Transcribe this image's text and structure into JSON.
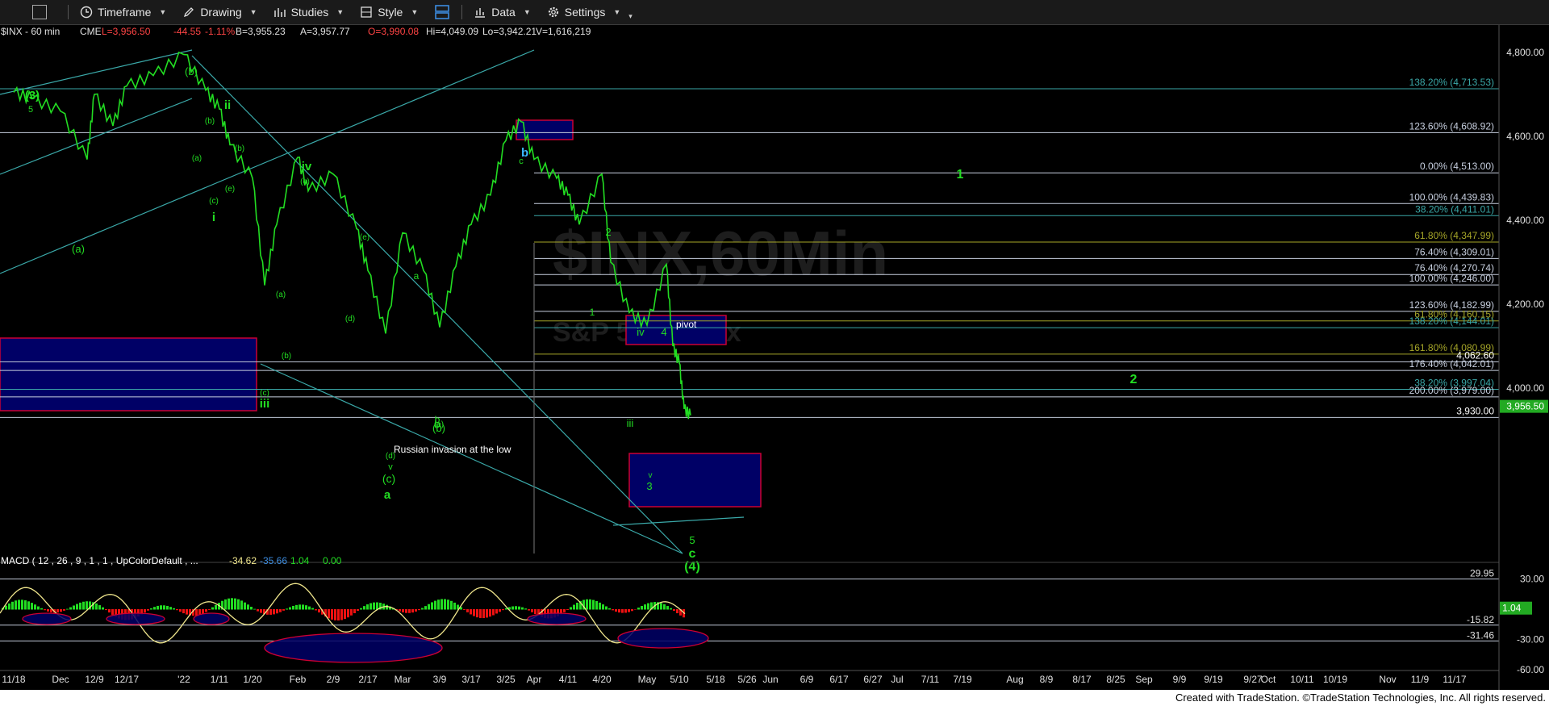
{
  "toolbar": {
    "items": [
      "Timeframe",
      "Drawing",
      "Studies",
      "Style",
      "Data",
      "Settings"
    ]
  },
  "header": {
    "symbol": "$INX - 60 min",
    "exchange": "CME",
    "last": "L=3,956.50",
    "change": "-44.55",
    "change_pct": "-1.11%",
    "bid": "B=3,955.23",
    "ask": "A=3,957.77",
    "open": "O=3,990.08",
    "high": "Hi=4,049.09",
    "low": "Lo=3,942.21",
    "volume": "V=1,616,219"
  },
  "watermark": {
    "line1": "$INX,60Min",
    "line2": "S&P 500 Index"
  },
  "colors": {
    "price": "#22dd22",
    "wave_label": "#22dd22",
    "fib_line": "#d0d8e8",
    "fib_label": "#c8d0e0",
    "teal": "#3aa8a8",
    "olive": "#a6a628",
    "box_fill": "#000066",
    "box_border": "#cc0033",
    "macd_line": "#f0e68c",
    "macd_pos": "#22dd22",
    "macd_neg": "#ee1111",
    "last_price_bg": "#22aa22"
  },
  "chart_data": {
    "type": "line",
    "title": "$INX - 60 min",
    "ylim": [
      3800,
      4880
    ],
    "y_ticks": [
      "4,800.00",
      "4,600.00",
      "4,400.00",
      "4,200.00",
      "4,000.00"
    ],
    "x_ticks": [
      "11/18",
      "Dec",
      "12/9",
      "12/17",
      "'22",
      "1/11",
      "1/20",
      "Feb",
      "2/9",
      "2/17",
      "Mar",
      "3/9",
      "3/17",
      "3/25",
      "Apr",
      "4/11",
      "4/20",
      "May",
      "5/10",
      "5/18",
      "5/26",
      "Jun",
      "6/9",
      "6/17",
      "6/27",
      "Jul",
      "7/11",
      "7/19",
      "Aug",
      "8/9",
      "8/17",
      "8/25",
      "Sep",
      "9/9",
      "9/19",
      "9/27",
      "Oct",
      "10/11",
      "10/19",
      "Nov",
      "11/9",
      "11/17"
    ],
    "series": [
      {
        "x": [
          "11/18",
          "11/26",
          "Dec",
          "12/6",
          "12/9",
          "12/14",
          "12/17",
          "12/22",
          "'22",
          "1/5",
          "1/11",
          "1/14",
          "1/20",
          "1/24",
          "1/27",
          "Feb",
          "2/2",
          "2/9",
          "2/14",
          "2/17",
          "2/24",
          "Mar",
          "3/4",
          "3/9",
          "3/14",
          "3/17",
          "3/22",
          "3/25",
          "3/29",
          "Apr",
          "4/6",
          "4/11",
          "4/14",
          "4/20",
          "4/22",
          "4/26",
          "May",
          "5/4",
          "5/5",
          "5/10",
          "5/11",
          "5/12"
        ],
        "values": [
          4705,
          4690,
          4660,
          4545,
          4700,
          4625,
          4720,
          4745,
          4795,
          4710,
          4665,
          4580,
          4500,
          4245,
          4390,
          4550,
          4470,
          4510,
          4380,
          4280,
          4130,
          4370,
          4280,
          4145,
          4290,
          4390,
          4460,
          4590,
          4635,
          4545,
          4500,
          4460,
          4390,
          4510,
          4300,
          4180,
          4150,
          4295,
          4100,
          4060,
          3950,
          3935
        ]
      }
    ],
    "fib_levels": [
      {
        "label": "138.20% (4,713.53)",
        "value": 4713.53,
        "color": "#3aa8a8"
      },
      {
        "label": "123.60% (4,608.92)",
        "value": 4608.92,
        "color": "#c8d0e0"
      },
      {
        "label": "0.00% (4,513.00)",
        "value": 4513.0,
        "color": "#c8d0e0"
      },
      {
        "label": "100.00% (4,439.83)",
        "value": 4439.83,
        "color": "#c8d0e0"
      },
      {
        "label": "38.20% (4,411.01)",
        "value": 4411.01,
        "color": "#3aa8a8"
      },
      {
        "label": "61.80% (4,347.99)",
        "value": 4347.99,
        "color": "#a6a628"
      },
      {
        "label": "76.40% (4,309.01)",
        "value": 4309.01,
        "color": "#c8d0e0"
      },
      {
        "label": "76.40% (4,270.74)",
        "value": 4270.74,
        "color": "#c8d0e0"
      },
      {
        "label": "100.00% (4,246.00)",
        "value": 4246.0,
        "color": "#c8d0e0"
      },
      {
        "label": "123.60% (4,182.99)",
        "value": 4182.99,
        "color": "#c8d0e0"
      },
      {
        "label": "61.80% (4,160.15)",
        "value": 4160.15,
        "color": "#a6a628"
      },
      {
        "label": "138.20% (4,144.01)",
        "value": 4144.01,
        "color": "#3aa8a8"
      },
      {
        "label": "161.80% (4,080.99)",
        "value": 4080.99,
        "color": "#a6a628"
      },
      {
        "label": "4,062.60",
        "value": 4062.6,
        "color": "#ffffff"
      },
      {
        "label": "176.40% (4,042.01)",
        "value": 4042.01,
        "color": "#c8d0e0"
      },
      {
        "label": "38.20% (3,997.04)",
        "value": 3997.04,
        "color": "#3aa8a8"
      },
      {
        "label": "200.00% (3,979.00)",
        "value": 3979.0,
        "color": "#c8d0e0"
      },
      {
        "label": "3,930.00",
        "value": 3930.0,
        "color": "#ffffff"
      }
    ],
    "last_price": "3,956.50",
    "wave_labels": [
      "(3)",
      "5",
      "(b)",
      "ii",
      "(b)",
      "(a)",
      "(c)",
      "(e)",
      "(b)",
      "i",
      "(a)",
      "iv",
      "(c)",
      "(e)",
      "(d)",
      "(a)",
      "(b)",
      "(c)",
      "iii",
      "(b)",
      "(a)",
      "b",
      "a",
      "(d)",
      "v",
      "(c)",
      "a",
      "b",
      "c",
      "2",
      "1",
      "iv",
      "4",
      "iii",
      "v",
      "3",
      "5",
      "c",
      "(4)",
      "1",
      "2"
    ],
    "annotations": [
      "Russian invasion at the low",
      "pivot"
    ],
    "macd": {
      "label": "MACD ( 12 , 26 , 9 , 1 , 1 , UpColorDefault , ...",
      "values": [
        "-34.62",
        "-35.66",
        "1.04",
        "0.00"
      ],
      "y_ticks": [
        "30.00",
        "-30.00",
        "-60.00"
      ],
      "levels": [
        "29.95",
        "-15.82",
        "-31.46"
      ],
      "last_value": "1.04"
    }
  },
  "footer": {
    "credit": "Created with TradeStation. ©TradeStation Technologies, Inc. All rights reserved."
  }
}
